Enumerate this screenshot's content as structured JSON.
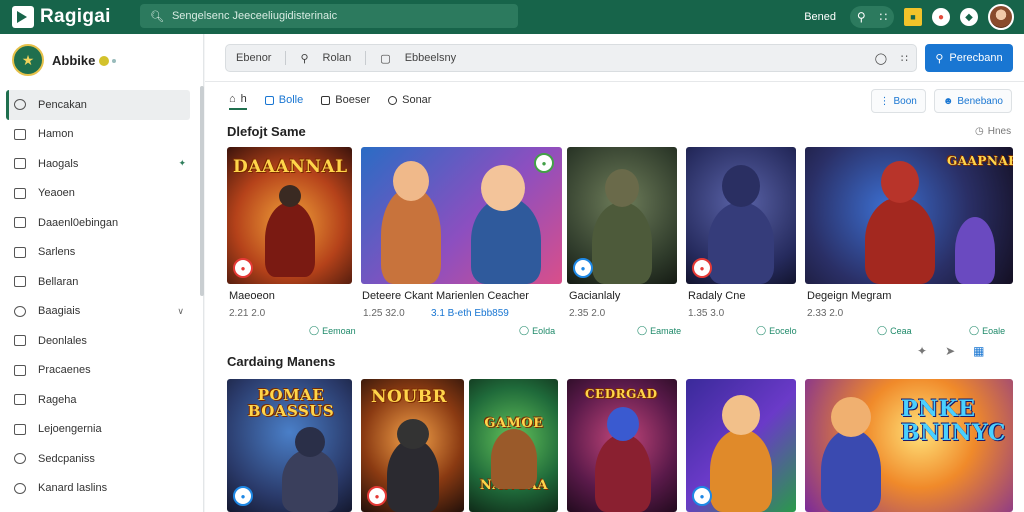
{
  "topbar": {
    "logo_text": "Ragigai",
    "search_placeholder": "Sengelsenc Jeeceeliugidisterinaic",
    "right_label": "Bened",
    "bg_color": "#17644a"
  },
  "sidebar": {
    "profile_name": "Abbike",
    "items": [
      {
        "label": "Pencakan",
        "icon": "search-icon"
      },
      {
        "label": "Hamon",
        "icon": "folder-icon"
      },
      {
        "label": "Haogals",
        "icon": "chart-icon"
      },
      {
        "label": "Yeaoen",
        "icon": "document-icon"
      },
      {
        "label": "Daaenl0ebingan",
        "icon": "grid-icon"
      },
      {
        "label": "Sarlens",
        "icon": "star-icon"
      },
      {
        "label": "Bellaran",
        "icon": "calendar-icon"
      },
      {
        "label": "Baagiais",
        "icon": "shield-icon"
      },
      {
        "label": "Deonlales",
        "icon": "tools-icon"
      },
      {
        "label": "Pracaenes",
        "icon": "box-icon"
      },
      {
        "label": "Rageha",
        "icon": "book-icon"
      },
      {
        "label": "Lejoengernia",
        "icon": "layers-icon"
      },
      {
        "label": "Sedcpaniss",
        "icon": "settings-icon"
      },
      {
        "label": "Kanard laslins",
        "icon": "info-icon"
      }
    ]
  },
  "filter_bar": {
    "field1": "Ebenor",
    "field2": "Rolan",
    "field3": "Ebbeelsny",
    "primary_button": "Perecbann"
  },
  "tabs": [
    {
      "label": "h",
      "icon": "home-icon"
    },
    {
      "label": "Bolle",
      "icon": "list-icon"
    },
    {
      "label": "Boeser",
      "icon": "gamepad-icon"
    },
    {
      "label": "Sonar",
      "icon": "circle-icon"
    }
  ],
  "tab_buttons": [
    "Boon",
    "Benebano"
  ],
  "section1": {
    "title": "Dlefojt Same",
    "action": "Hnes",
    "cards": [
      {
        "art": "DAAANNAL",
        "title": "Maeoeon",
        "meta": "2.21 2.0",
        "meta2": "",
        "link": "Eemoan"
      },
      {
        "art": "",
        "title": "Deteere Ckant Marienlen Ceacher",
        "meta": "1.25 32.0",
        "meta2": "3.1 B-eth Ebb859",
        "link": "Eolda"
      },
      {
        "art": "",
        "title": "Gacianlaly",
        "meta": "2.35 2.0",
        "meta2": "",
        "link": "Eamate"
      },
      {
        "art": "",
        "title": "Radaly Cne",
        "meta": "1.35 3.0",
        "meta2": "",
        "link": "Eocelo"
      },
      {
        "art": "GAAPNAE",
        "title": "Degeign Megram",
        "meta": "2.33 2.0",
        "meta2": "",
        "link": "Ceaa"
      },
      {
        "art": "",
        "title": "",
        "meta": "",
        "meta2": "",
        "link": "Eoale"
      }
    ]
  },
  "section2": {
    "title": "Cardaing Manens",
    "cards": [
      {
        "art": "POMAE BOASSUS"
      },
      {
        "art": "NOUBR"
      },
      {
        "art": "GAMOE NANGAA"
      },
      {
        "art": "CEDRGAD"
      },
      {
        "art": ""
      },
      {
        "art": "PNKE BNINYC"
      }
    ]
  }
}
